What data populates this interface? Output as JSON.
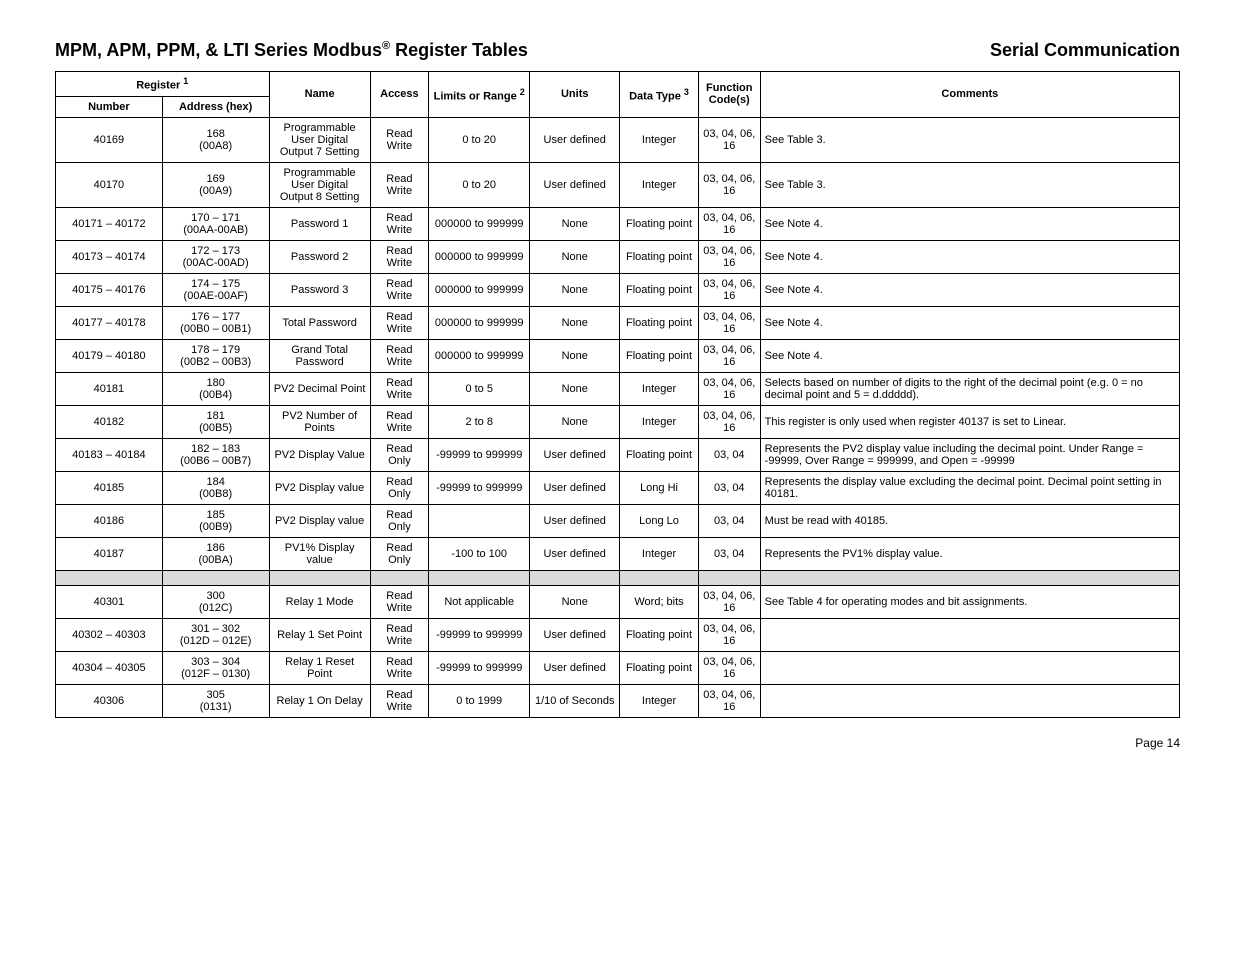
{
  "header": {
    "title_prefix": "MPM, APM, PPM, & LTI Series Modbus",
    "title_suffix": " Register Tables",
    "reg_symbol": "®",
    "right": "Serial Communication"
  },
  "footer": {
    "page": "Page 14"
  },
  "table": {
    "headers": {
      "register": "Register",
      "register_sup": "1",
      "number": "Number",
      "address": "Address (hex)",
      "name": "Name",
      "access": "Access",
      "limits": "Limits or Range",
      "limits_sup": "2",
      "units": "Units",
      "data_type": "Data Type",
      "data_type_sup": "3",
      "function_codes": "Function Code(s)",
      "comments": "Comments"
    },
    "rows": [
      {
        "number": "40169",
        "addr": "168",
        "hex": "(00A8)",
        "name": "Programmable User Digital Output 7 Setting",
        "access": "Read Write",
        "range": "0 to 20",
        "units": "User defined",
        "dtype": "Integer",
        "fcode": "03, 04, 06, 16",
        "comments": "See Table 3."
      },
      {
        "number": "40170",
        "addr": "169",
        "hex": "(00A9)",
        "name": "Programmable User Digital Output 8 Setting",
        "access": "Read Write",
        "range": "0 to 20",
        "units": "User defined",
        "dtype": "Integer",
        "fcode": "03, 04, 06, 16",
        "comments": "See Table 3."
      },
      {
        "number": "40171 – 40172",
        "addr": "170 – 171",
        "hex": "(00AA-00AB)",
        "name": "Password 1",
        "access": "Read Write",
        "range": "000000 to 999999",
        "units": "None",
        "dtype": "Floating point",
        "fcode": "03, 04, 06, 16",
        "comments": "See Note 4."
      },
      {
        "number": "40173 – 40174",
        "addr": "172 – 173",
        "hex": "(00AC-00AD)",
        "name": "Password 2",
        "access": "Read Write",
        "range": "000000 to 999999",
        "units": "None",
        "dtype": "Floating point",
        "fcode": "03, 04, 06, 16",
        "comments": "See Note 4."
      },
      {
        "number": "40175 – 40176",
        "addr": "174 – 175",
        "hex": "(00AE-00AF)",
        "name": "Password 3",
        "access": "Read Write",
        "range": "000000 to 999999",
        "units": "None",
        "dtype": "Floating point",
        "fcode": "03, 04, 06, 16",
        "comments": "See Note 4."
      },
      {
        "number": "40177 – 40178",
        "addr": "176 – 177",
        "hex": "(00B0 – 00B1)",
        "name": "Total Password",
        "access": "Read Write",
        "range": "000000 to 999999",
        "units": "None",
        "dtype": "Floating point",
        "fcode": "03, 04, 06, 16",
        "comments": "See Note 4."
      },
      {
        "number": "40179 – 40180",
        "addr": "178 – 179",
        "hex": "(00B2 – 00B3)",
        "name": "Grand Total Password",
        "access": "Read Write",
        "range": "000000 to 999999",
        "units": "None",
        "dtype": "Floating point",
        "fcode": "03, 04, 06, 16",
        "comments": "See Note 4."
      },
      {
        "number": "40181",
        "addr": "180",
        "hex": "(00B4)",
        "name": "PV2 Decimal Point",
        "access": "Read Write",
        "range": "0 to 5",
        "units": "None",
        "dtype": "Integer",
        "fcode": "03, 04, 06, 16",
        "comments": "Selects based on number of digits to the right of the decimal point (e.g. 0 = no decimal point and 5 = d.ddddd)."
      },
      {
        "number": "40182",
        "addr": "181",
        "hex": "(00B5)",
        "name": "PV2 Number of Points",
        "access": "Read Write",
        "range": "2 to 8",
        "units": "None",
        "dtype": "Integer",
        "fcode": "03, 04, 06, 16",
        "comments": "This register is only used when register 40137 is set to Linear."
      },
      {
        "number": "40183 – 40184",
        "addr": "182 – 183",
        "hex": "(00B6 – 00B7)",
        "name": "PV2 Display Value",
        "access": "Read Only",
        "range": "-99999 to 999999",
        "units": "User defined",
        "dtype": "Floating point",
        "fcode": "03, 04",
        "comments": "Represents the PV2 display value including the decimal point. Under Range = -99999, Over Range = 999999, and Open = -99999"
      },
      {
        "number": "40185",
        "addr": "184",
        "hex": "(00B8)",
        "name": "PV2 Display value",
        "access": "Read Only",
        "range": "-99999 to 999999",
        "units": "User defined",
        "dtype": "Long Hi",
        "fcode": "03, 04",
        "comments": "Represents the display value excluding the decimal point. Decimal point setting in 40181."
      },
      {
        "number": "40186",
        "addr": "185",
        "hex": "(00B9)",
        "name": "PV2 Display value",
        "access": "Read Only",
        "range": "",
        "units": "User defined",
        "dtype": "Long Lo",
        "fcode": "03, 04",
        "comments": "Must be read with 40185."
      },
      {
        "number": "40187",
        "addr": "186",
        "hex": "(00BA)",
        "name": "PV1% Display value",
        "access": "Read Only",
        "range": "-100 to 100",
        "units": "User defined",
        "dtype": "Integer",
        "fcode": "03, 04",
        "comments": "Represents the PV1% display value."
      },
      {
        "spacer": true
      },
      {
        "number": "40301",
        "addr": "300",
        "hex": "(012C)",
        "name": "Relay 1 Mode",
        "access": "Read Write",
        "range": "Not applicable",
        "units": "None",
        "dtype": "Word; bits",
        "fcode": "03, 04, 06, 16",
        "comments": "See Table 4 for operating modes and bit assignments."
      },
      {
        "number": "40302 – 40303",
        "addr": "301 – 302",
        "hex": "(012D – 012E)",
        "name": "Relay 1 Set Point",
        "access": "Read Write",
        "range": "-99999 to 999999",
        "units": "User defined",
        "dtype": "Floating point",
        "fcode": "03, 04, 06, 16",
        "comments": ""
      },
      {
        "number": "40304 – 40305",
        "addr": "303 – 304",
        "hex": "(012F – 0130)",
        "name": "Relay 1 Reset Point",
        "access": "Read Write",
        "range": "-99999 to 999999",
        "units": "User defined",
        "dtype": "Floating point",
        "fcode": "03, 04, 06, 16",
        "comments": ""
      },
      {
        "number": "40306",
        "addr": "305",
        "hex": "(0131)",
        "name": "Relay 1 On Delay",
        "access": "Read Write",
        "range": "0 to 1999",
        "units": "1/10 of Seconds",
        "dtype": "Integer",
        "fcode": "03, 04, 06, 16",
        "comments": ""
      }
    ]
  }
}
